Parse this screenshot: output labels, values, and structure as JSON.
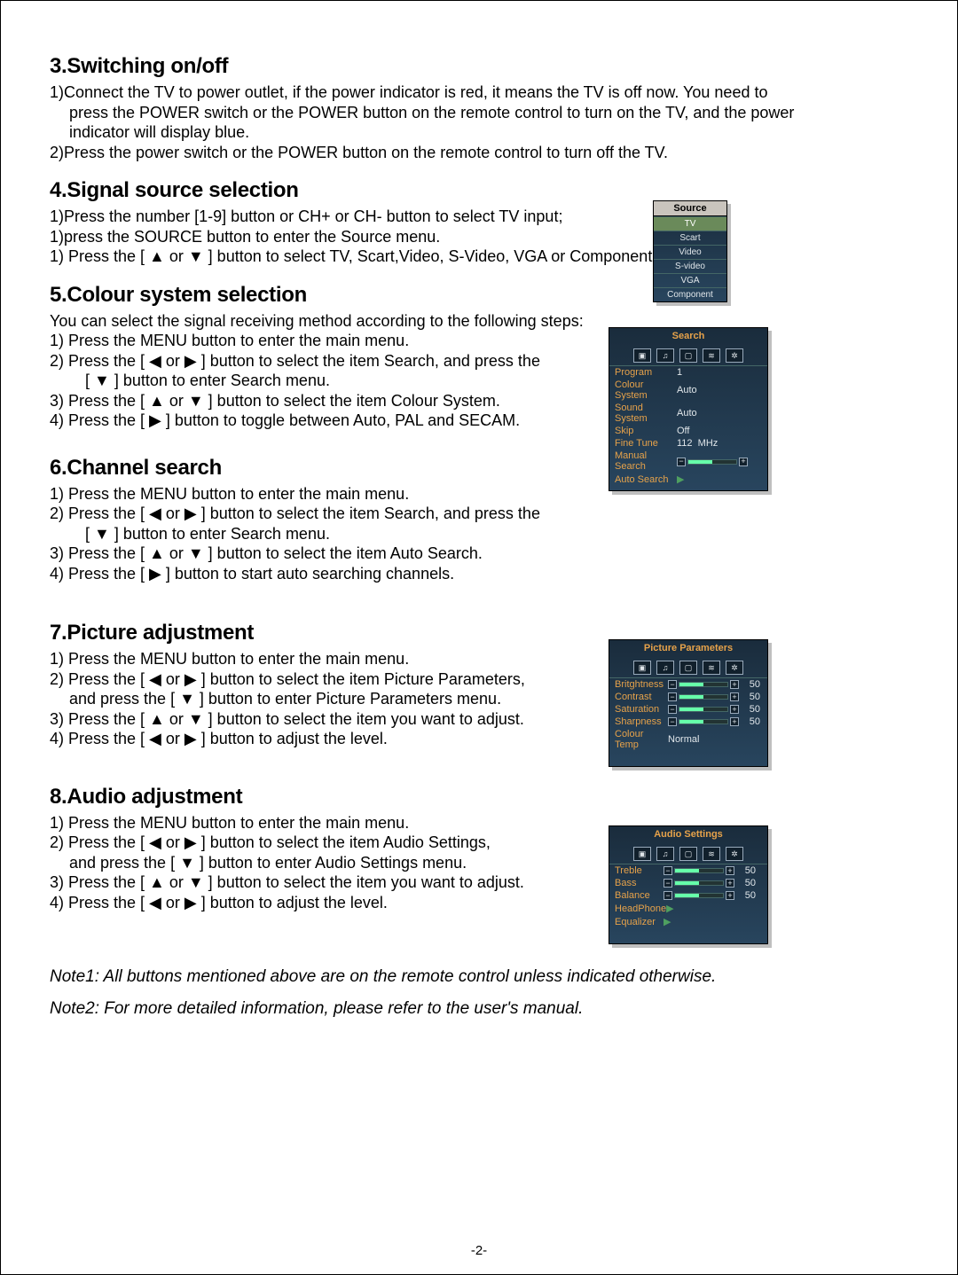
{
  "sections": {
    "switching": {
      "heading": "3.Switching on/off",
      "lines": [
        "1)Connect the TV  to power outlet, if the power indicator is red, it means the TV is off now. You need to",
        "press the POWER switch or the POWER button on the remote control to turn on the TV, and the  power",
        "indicator will display blue.",
        "2)Press the power switch or the POWER button on the remote control to turn off  the TV."
      ]
    },
    "signal": {
      "heading": "4.Signal source selection",
      "lines": [
        "1)Press the number [1-9] button or CH+ or CH- button to select TV input;",
        "1)press the SOURCE button to enter the Source  menu.",
        "1) Press the [ ▲ or ▼ ] button to select TV, Scart,Video, S-Video, VGA or Component."
      ]
    },
    "colour": {
      "heading": "5.Colour system selection",
      "intro": "You can select the signal receiving method according to the following steps:",
      "lines": [
        "1) Press the MENU button to enter the main menu.",
        "2) Press the [ ◀ or ▶ ] button to select the item Search, and press the",
        "[ ▼ ] button to enter Search menu.",
        "3) Press the [ ▲ or ▼ ] button to select the item Colour  System.",
        "4) Press the [ ▶ ] button to toggle between Auto, PAL and SECAM."
      ]
    },
    "channel": {
      "heading": "6.Channel search",
      "lines": [
        "1) Press the MENU button to enter the main menu.",
        "2) Press the [ ◀ or ▶ ] button to select the item Search, and press the",
        "[ ▼ ] button to enter Search  menu.",
        "3) Press the [ ▲ or ▼ ] button to select the item Auto Search.",
        "4) Press the [ ▶ ]  button to start auto  searching  channels."
      ]
    },
    "picture": {
      "heading": "7.Picture adjustment",
      "lines": [
        "1) Press the MENU button to enter the main menu.",
        "2) Press the [ ◀ or ▶ ] button to select the item Picture Parameters,",
        "and press the [ ▼ ] button  to enter Picture Parameters menu.",
        "3) Press the [ ▲ or ▼ ] button to select the item you want to adjust.",
        "4) Press the [ ◀ or ▶ ] button to adjust the level."
      ]
    },
    "audio": {
      "heading": "8.Audio adjustment",
      "lines": [
        "1) Press the MENU button to enter the main menu.",
        "2) Press the [ ◀ or ▶ ] button to select the item Audio Settings,",
        "and press the [ ▼ ] button to enter Audio Settings menu.",
        "3) Press the [ ▲ or ▼ ] button to select the item you want  to adjust.",
        "4) Press the [ ◀ or ▶ ] button  to adjust the level."
      ]
    }
  },
  "notes": {
    "n1": "Note1: All buttons mentioned above are on the remote control unless indicated otherwise.",
    "n2": "Note2: For more detailed information, please refer to the user's manual."
  },
  "page_num": "-2-",
  "osd_source": {
    "title": "Source",
    "items": [
      "TV",
      "Scart",
      "Video",
      "S-video",
      "VGA",
      "Component"
    ],
    "selected": "TV"
  },
  "osd_search": {
    "title": "Search",
    "rows": {
      "program": {
        "label": "Program",
        "value": "1"
      },
      "colour_system": {
        "label": "Colour System",
        "value": "Auto"
      },
      "sound_system": {
        "label": "Sound System",
        "value": "Auto"
      },
      "skip": {
        "label": "Skip",
        "value": "Off"
      },
      "fine_tune": {
        "label": "Fine Tune",
        "value": "112",
        "unit": "MHz"
      },
      "manual_search": {
        "label": "Manual Search"
      },
      "auto_search": {
        "label": "Auto Search"
      }
    }
  },
  "osd_picture": {
    "title": "Picture Parameters",
    "rows": {
      "brightness": {
        "label": "Britghtness",
        "value": "50"
      },
      "contrast": {
        "label": "Contrast",
        "value": "50"
      },
      "saturation": {
        "label": "Saturation",
        "value": "50"
      },
      "sharpness": {
        "label": "Sharpness",
        "value": "50"
      },
      "colour_temp": {
        "label": "Colour Temp",
        "value": "Normal"
      }
    }
  },
  "osd_audio": {
    "title": "Audio Settings",
    "rows": {
      "treble": {
        "label": "Treble",
        "value": "50"
      },
      "bass": {
        "label": "Bass",
        "value": "50"
      },
      "balance": {
        "label": "Balance",
        "value": "50"
      },
      "headphone": {
        "label": "HeadPhone"
      },
      "equalizer": {
        "label": "Equalizer"
      }
    }
  }
}
